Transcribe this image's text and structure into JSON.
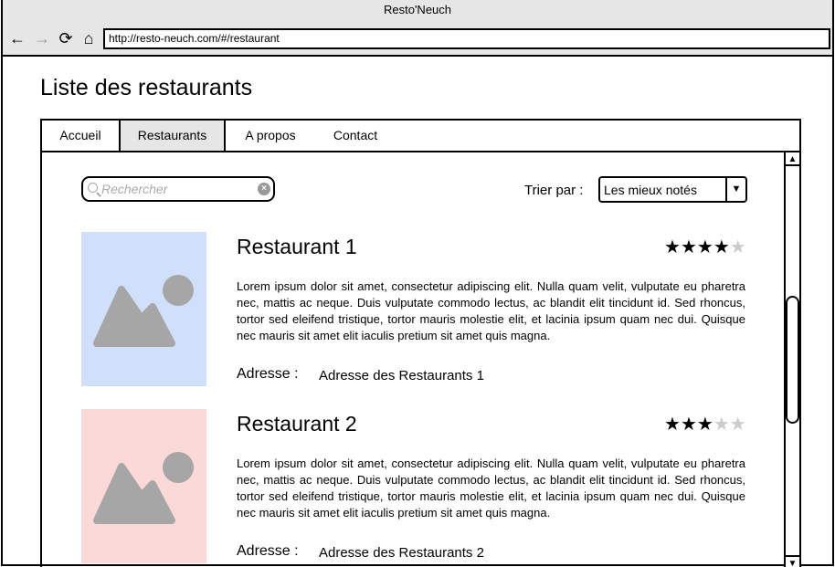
{
  "browser": {
    "title": "Resto'Neuch",
    "url": "http://resto-neuch.com/#/restaurant"
  },
  "page": {
    "title": "Liste des restaurants"
  },
  "nav": {
    "tabs": [
      {
        "label": "Accueil",
        "active": false
      },
      {
        "label": "Restaurants",
        "active": true
      },
      {
        "label": "A propos",
        "active": false
      },
      {
        "label": "Contact",
        "active": false
      }
    ]
  },
  "search": {
    "placeholder": "Rechercher",
    "value": ""
  },
  "sort": {
    "label": "Trier par :",
    "selected": "Les mieux notés"
  },
  "restaurants": [
    {
      "name": "Restaurant 1",
      "rating": 4,
      "max_rating": 5,
      "description": "Lorem ipsum dolor sit amet, consectetur adipiscing elit. Nulla quam velit, vulputate eu pharetra nec, mattis ac neque. Duis vulputate commodo lectus, ac blandit elit tincidunt id. Sed rhoncus, tortor sed eleifend tristique, tortor mauris molestie elit, et lacinia ipsum quam nec dui. Quisque nec mauris sit amet elit iaculis pretium sit amet quis magna.",
      "address_label": "Adresse :",
      "address": "Adresse des Restaurants 1",
      "image_color": "#d0e0fa"
    },
    {
      "name": "Restaurant 2",
      "rating": 3,
      "max_rating": 5,
      "description": "Lorem ipsum dolor sit amet, consectetur adipiscing elit. Nulla quam velit, vulputate eu pharetra nec, mattis ac neque. Duis vulputate commodo lectus, ac blandit elit tincidunt id. Sed rhoncus, tortor sed eleifend tristique, tortor mauris molestie elit, et lacinia ipsum quam nec dui. Quisque nec mauris sit amet elit iaculis pretium sit amet quis magna.",
      "address_label": "Adresse :",
      "address": "Adresse des Restaurants 2",
      "image_color": "#fcd9d9"
    }
  ],
  "icons": {
    "back": "arrow-left-icon",
    "forward": "arrow-right-icon",
    "reload": "reload-icon",
    "home": "home-icon",
    "search": "search-icon",
    "clear": "clear-icon",
    "dropdown": "chevron-down-icon",
    "image": "image-placeholder-icon",
    "star": "star-icon"
  },
  "colors": {
    "chrome": "#e6e6e6",
    "image_glyph": "#a6a6a6",
    "star_on": "#000000",
    "star_off": "#cccccc"
  }
}
